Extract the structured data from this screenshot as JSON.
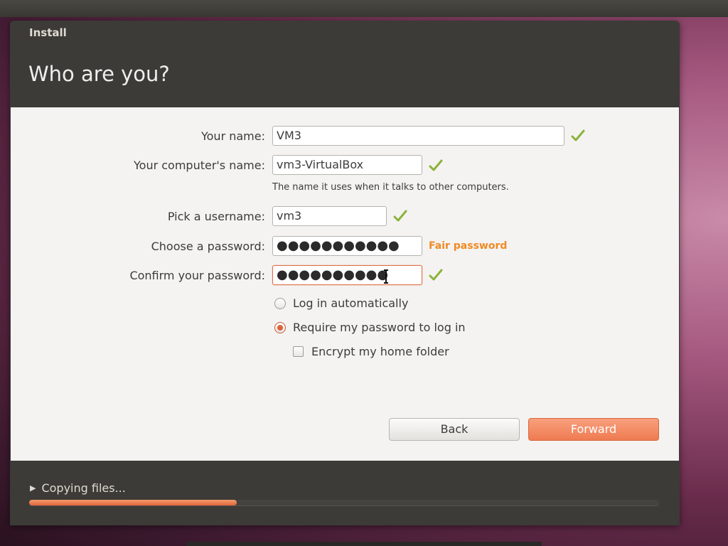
{
  "window": {
    "title": "Install",
    "heading": "Who are you?"
  },
  "form": {
    "name_label": "Your name:",
    "name_value": "VM3",
    "computer_label": "Your computer's name:",
    "computer_value": "vm3-VirtualBox",
    "computer_hint": "The name it uses when it talks to other computers.",
    "username_label": "Pick a username:",
    "username_value": "vm3",
    "password_label": "Choose a password:",
    "password_value": "●●●●●●●●●●●",
    "password_strength": "Fair password",
    "confirm_label": "Confirm your password:",
    "confirm_value": "●●●●●●●●●●",
    "login_auto_label": "Log in automatically",
    "login_auto_selected": false,
    "require_password_label": "Require my password to log in",
    "require_password_selected": true,
    "encrypt_label": "Encrypt my home folder",
    "encrypt_checked": false
  },
  "buttons": {
    "back": "Back",
    "forward": "Forward"
  },
  "progress": {
    "label": "Copying files...",
    "fraction": 0.33
  },
  "icons": {
    "valid": "checkmark-icon",
    "expander": "triangle-right-icon",
    "cursor": "text-cursor-icon"
  },
  "colors": {
    "accent": "#ef7b52",
    "check": "#8bb33a",
    "strength": "#f08a24"
  }
}
